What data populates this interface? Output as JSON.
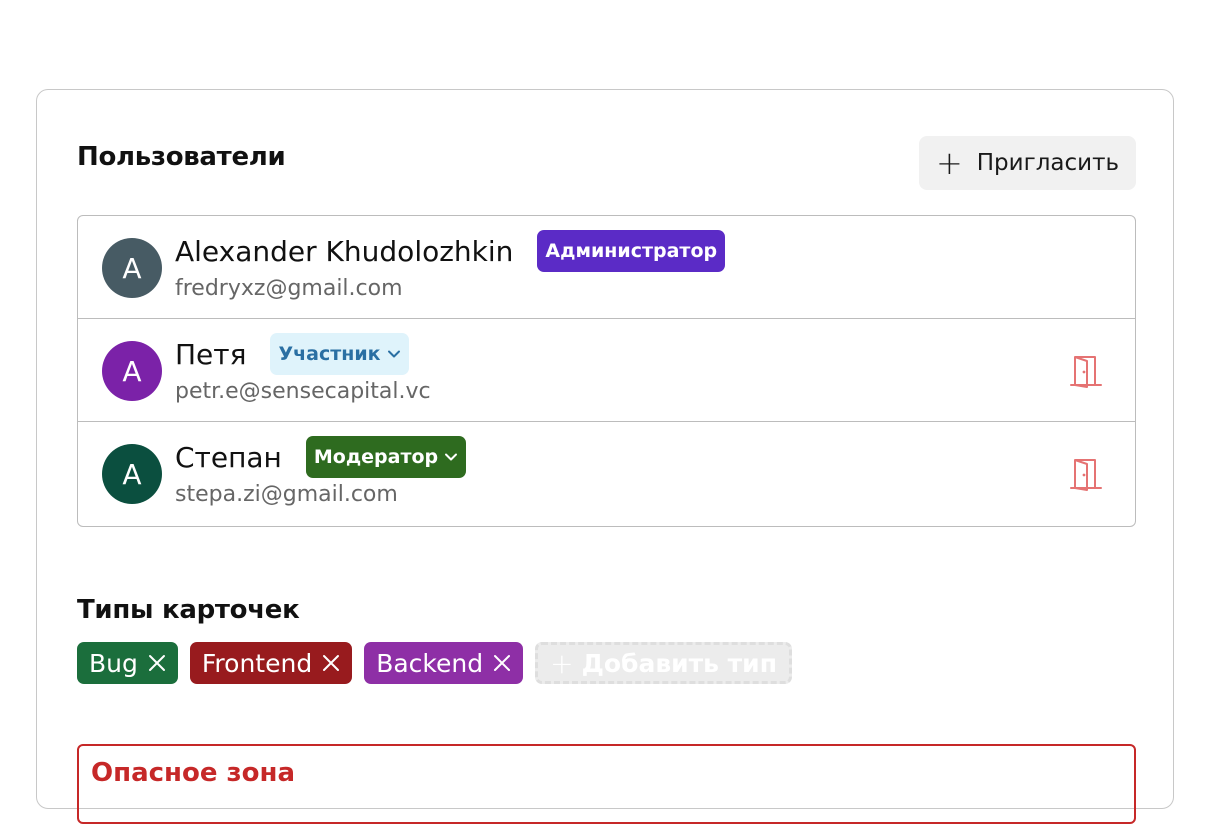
{
  "users_section": {
    "title": "Пользователи",
    "invite_label": "Пригласить"
  },
  "users": [
    {
      "avatar_letter": "A",
      "avatar_color": "#475b64",
      "name": "Alexander Khudolozhkin",
      "email": "fredryxz@gmail.com",
      "role": "Администратор",
      "role_bg": "#5b2bc6",
      "role_fg": "#ffffff",
      "role_dropdown": false,
      "removable": false
    },
    {
      "avatar_letter": "A",
      "avatar_color": "#7b22a8",
      "name": "Петя",
      "email": "petr.e@sensecapital.vc",
      "role": "Участник",
      "role_bg": "#dff3fb",
      "role_fg": "#2a6fa3",
      "role_dropdown": true,
      "removable": true
    },
    {
      "avatar_letter": "A",
      "avatar_color": "#0b4f3f",
      "name": "Степан",
      "email": "stepa.zi@gmail.com",
      "role": "Модератор",
      "role_bg": "#2e6b1f",
      "role_fg": "#ffffff",
      "role_dropdown": true,
      "removable": true
    }
  ],
  "card_types_section": {
    "title": "Типы карточек",
    "add_label": "Добавить тип"
  },
  "card_types": [
    {
      "label": "Bug",
      "color": "#1b6e3c"
    },
    {
      "label": "Frontend",
      "color": "#981b1e"
    },
    {
      "label": "Backend",
      "color": "#8e2fa6"
    }
  ],
  "danger_zone": {
    "title": "Опасное зона",
    "color": "#c62828"
  },
  "icons": {
    "invite": "plus-icon",
    "remove_user": "door-exit-icon",
    "remove_type": "close-icon",
    "role_dropdown": "chevron-down-icon"
  }
}
